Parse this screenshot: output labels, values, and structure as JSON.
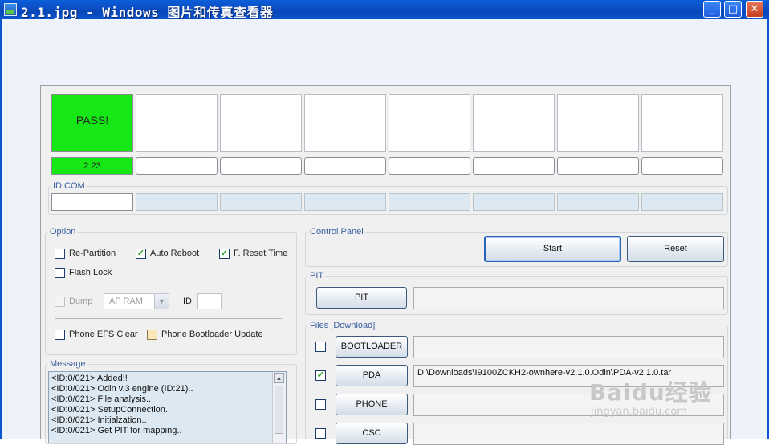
{
  "window": {
    "title": "2.1.jpg - Windows 图片和传真查看器",
    "buttons": {
      "minimize": "_",
      "maximize": "□",
      "close": "✕"
    }
  },
  "odin": {
    "slots": [
      "PASS!",
      "",
      "",
      "",
      "",
      "",
      "",
      ""
    ],
    "timers": [
      "2:23",
      "",
      "",
      "",
      "",
      "",
      "",
      ""
    ],
    "id_com_label": "ID:COM",
    "option": {
      "label": "Option",
      "re_partition": {
        "label": "Re-Partition",
        "checked": false
      },
      "auto_reboot": {
        "label": "Auto Reboot",
        "checked": true
      },
      "f_reset_time": {
        "label": "F. Reset Time",
        "checked": true
      },
      "flash_lock": {
        "label": "Flash Lock",
        "checked": false
      },
      "dump": {
        "label": "Dump",
        "checked": false
      },
      "dump_select": "AP RAM",
      "id_label": "ID",
      "phone_efs_clear": {
        "label": "Phone EFS Clear",
        "checked": false
      },
      "phone_bootloader_update": {
        "label": "Phone Bootloader Update",
        "checked": false
      }
    },
    "message": {
      "label": "Message",
      "lines": [
        "<ID:0/021> Added!!",
        "<ID:0/021> Odin v.3 engine (ID:21)..",
        "<ID:0/021> File analysis..",
        "<ID:0/021> SetupConnection..",
        "<ID:0/021> Initialzation..",
        "<ID:0/021> Get PIT for mapping.."
      ]
    },
    "control_panel": {
      "label": "Control Panel",
      "start": "Start",
      "reset": "Reset"
    },
    "pit": {
      "label": "PIT",
      "button": "PIT",
      "path": ""
    },
    "files": {
      "label": "Files [Download]",
      "rows": [
        {
          "button": "BOOTLOADER",
          "checked": false,
          "path": ""
        },
        {
          "button": "PDA",
          "checked": true,
          "path": "D:\\Downloads\\I9100ZCKH2-ownhere-v2.1.0.Odin\\PDA-v2.1.0.tar"
        },
        {
          "button": "PHONE",
          "checked": false,
          "path": ""
        },
        {
          "button": "CSC",
          "checked": false,
          "path": ""
        }
      ]
    }
  },
  "watermark": {
    "brand": "Baidu经验",
    "url": "jingyan.baidu.com"
  },
  "colors": {
    "pass_green": "#16e816",
    "titlebar_blue": "#0a55d0",
    "message_bg": "#dde9f2"
  }
}
